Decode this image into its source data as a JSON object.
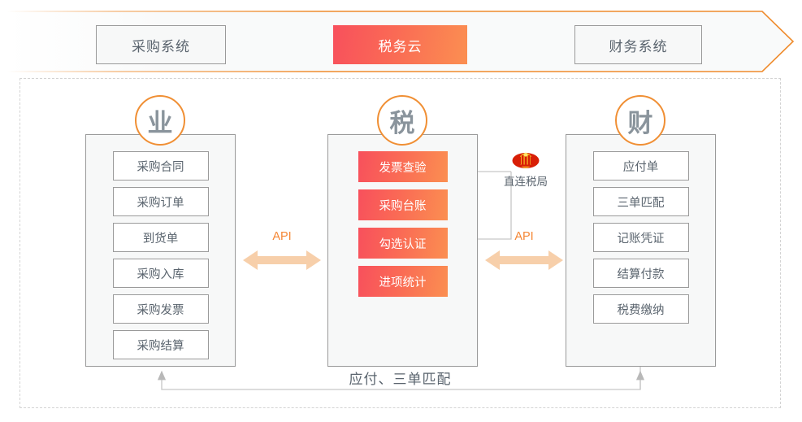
{
  "banner": {
    "items": [
      {
        "label": "采购系统",
        "style": "plain"
      },
      {
        "label": "税务云",
        "style": "accent"
      },
      {
        "label": "财务系统",
        "style": "plain"
      }
    ],
    "border_color": "#ef8b2c",
    "accent_gradient_from": "#f8505c",
    "accent_gradient_to": "#fb8f51"
  },
  "columns": [
    {
      "badge": "业",
      "items": [
        "采购合同",
        "采购订单",
        "到货单",
        "采购入库",
        "采购发票",
        "采购结算"
      ]
    },
    {
      "badge": "税",
      "items": [
        "发票查验",
        "采购台账",
        "勾选认证",
        "进项统计"
      ]
    },
    {
      "badge": "财",
      "items": [
        "应付单",
        "三单匹配",
        "记账凭证",
        "结算付款",
        "税费缴纳"
      ]
    }
  ],
  "connectors": {
    "api_left_label": "API",
    "api_right_label": "API",
    "api_color": "#f58634",
    "api_arrow_fill": "#f7cfaa",
    "bottom_label": "应付、三单匹配",
    "bottom_line_color": "#bfbfbf"
  },
  "tax_bureau": {
    "label": "直连税局",
    "icon": "tax-bureau-emblem-icon",
    "emblem_red": "#d81e06",
    "emblem_gold": "#fbc02d"
  },
  "badge_border_color": "#f08f34",
  "panel_bg": "#f7f8f8",
  "panel_border": "#9a9a9a"
}
